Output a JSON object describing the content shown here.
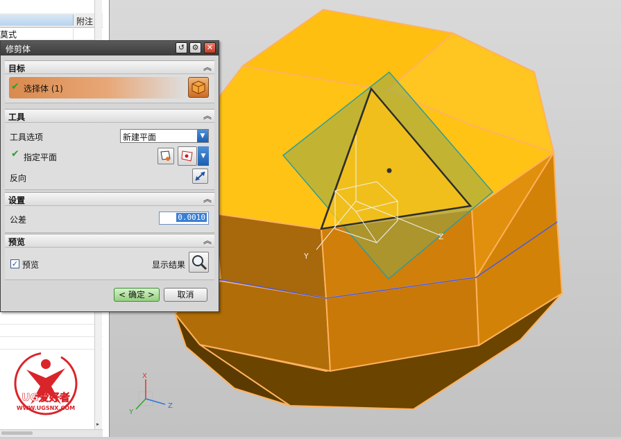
{
  "left_panel": {
    "header_col2": "附注",
    "row_label": "莫式"
  },
  "dialog": {
    "title": "修剪体",
    "sections": {
      "target": {
        "title": "目标",
        "select_body": "选择体 (1)"
      },
      "tool": {
        "title": "工具",
        "tool_option_label": "工具选项",
        "tool_option_value": "新建平面",
        "specify_plane": "指定平面",
        "reverse": "反向"
      },
      "settings": {
        "title": "设置",
        "tolerance_label": "公差",
        "tolerance_value": "0.0010"
      },
      "preview": {
        "title": "预览",
        "preview_label": "预览",
        "preview_checked": true,
        "show_result": "显示结果"
      }
    },
    "ok_button": "< 确定 >",
    "cancel_button": "取消"
  },
  "viewport": {
    "axis_x": "X",
    "axis_y": "Y",
    "axis_z": "Z",
    "plane_axis_y": "Y",
    "plane_axis_z": "Z"
  },
  "watermark": {
    "brand": "UG爱好者",
    "url": "WWW.UGSNX.COM"
  },
  "colors": {
    "solid_top": "#FFC316",
    "solid_side": "#DC8A0A",
    "solid_dark": "#6E4700",
    "plane_fill": "#8FA84A",
    "plane_edge": "#2E9C9C",
    "section_line": "#4E5AD8",
    "watermark_red": "#D9242A"
  }
}
